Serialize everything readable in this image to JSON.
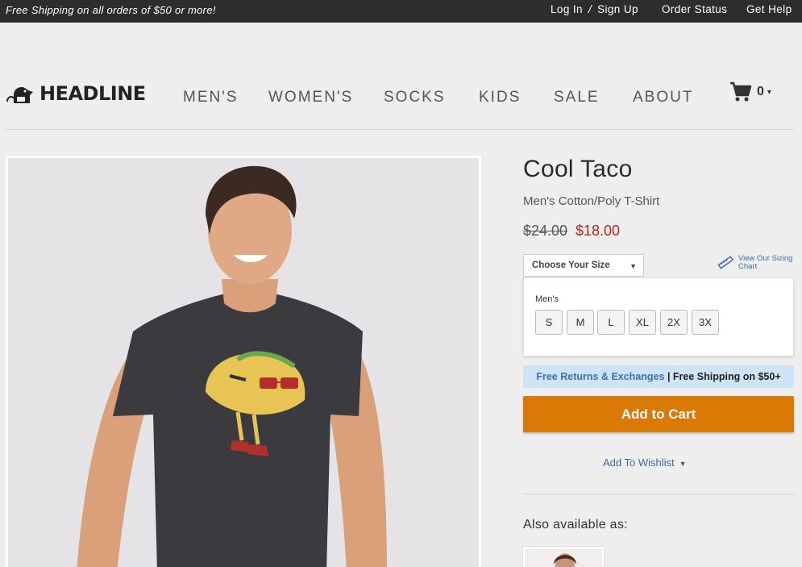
{
  "topbar": {
    "promo": "Free Shipping on all orders of $50 or more!",
    "login": "Log In",
    "separator": "/",
    "signup": "Sign Up",
    "order_status": "Order Status",
    "help": "Get Help"
  },
  "brand": {
    "logo": "HEADLINE"
  },
  "nav": [
    "MEN'S",
    "WOMEN'S",
    "SOCKS",
    "KIDS",
    "SALE",
    "ABOUT"
  ],
  "cart": {
    "count": "0",
    "icon": "cart-icon"
  },
  "product": {
    "title": "Cool Taco",
    "subtitle": "Men's Cotton/Poly T-Shirt",
    "old_price": "$24.00",
    "price": "$18.00",
    "size_select": "Choose Your Size",
    "sizing_chart": "View Our Sizing Chart",
    "size_group": "Men's",
    "sizes": [
      "S",
      "M",
      "L",
      "XL",
      "2X",
      "3X"
    ],
    "returns": "Free Returns & Exchanges",
    "shipping_sep": "|",
    "shipping": "Free Shipping on $50+",
    "add_to_cart": "Add to Cart",
    "wishlist": "Add To Wishlist",
    "also_available": "Also available as:"
  },
  "colors": {
    "accent": "#d97a06",
    "sale": "#b5231f",
    "link": "#3a6aa8",
    "topbar": "#2d2d2d"
  }
}
